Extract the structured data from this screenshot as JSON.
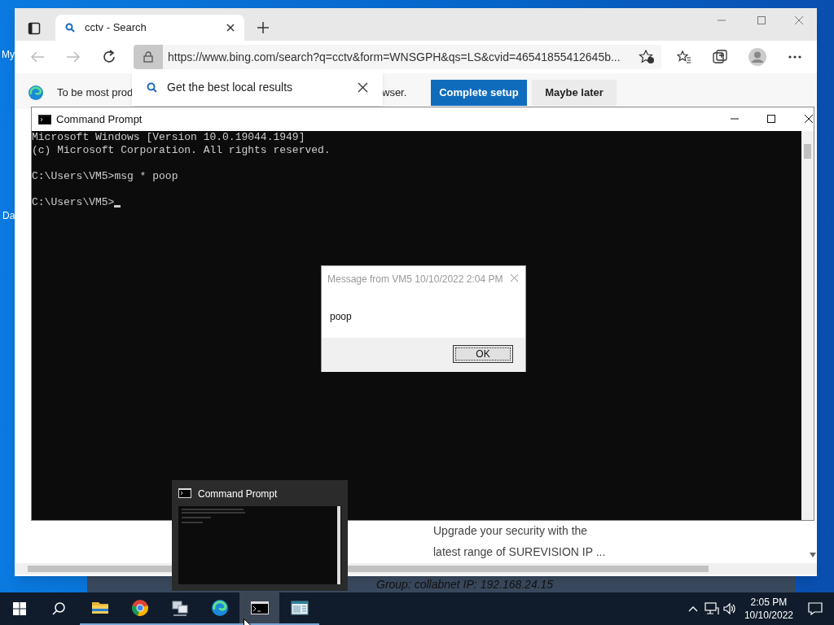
{
  "desktop": {
    "icon_labels": [
      "My",
      "Da"
    ]
  },
  "browser": {
    "tabs": [
      {
        "label": "cctv - Search",
        "selected": true
      }
    ],
    "address": "https://www.bing.com/search?q=cctv&form=WNSGPH&qs=LS&cvid=46541855412645b...",
    "infobar": {
      "text_start": "To be most prod",
      "text_end": "wser.",
      "buttons": [
        "Complete setup",
        "Maybe later"
      ]
    },
    "popup": {
      "title": "Get the best local results"
    },
    "content_lines": [
      "Upgrade your security with the",
      "latest range of SUREVISION IP ..."
    ]
  },
  "background_window": {
    "text": "Group: collabnet   IP: 192.168.24.15"
  },
  "cmd": {
    "title": "Command Prompt",
    "blocks": [
      [
        "Microsoft Windows [Version 10.0.19044.1949]",
        "(c) Microsoft Corporation. All rights reserved."
      ],
      [
        "C:\\Users\\VM5>msg * poop"
      ],
      [
        "C:\\Users\\VM5>"
      ]
    ]
  },
  "message_box": {
    "title": "Message from VM5 10/10/2022 2:04 PM",
    "body": "poop",
    "button": "OK"
  },
  "preview": {
    "title": "Command Prompt"
  },
  "taskbar": {
    "apps": [
      {
        "kind": "folder",
        "selected": false
      },
      {
        "kind": "browser",
        "selected": false
      },
      {
        "kind": "network",
        "selected": false
      },
      {
        "kind": "edge",
        "selected": false
      },
      {
        "kind": "cmd",
        "selected": true
      },
      {
        "kind": "window",
        "selected": false
      }
    ],
    "time": "2:05 PM",
    "date": "10/10/2022"
  }
}
